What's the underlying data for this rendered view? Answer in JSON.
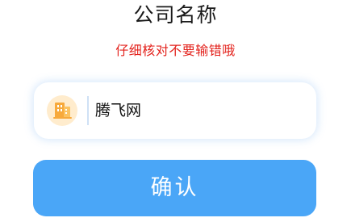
{
  "header": {
    "title": "公司名称",
    "hint": "仔细核对不要输错哦"
  },
  "company_field": {
    "value": "腾飞网",
    "icon": "building-icon"
  },
  "confirm_button": {
    "label": "确认"
  },
  "colors": {
    "hint": "#e3221c",
    "button": "#4aa6f7",
    "icon_bg": "#ffeccd",
    "icon": "#f7a93b"
  }
}
